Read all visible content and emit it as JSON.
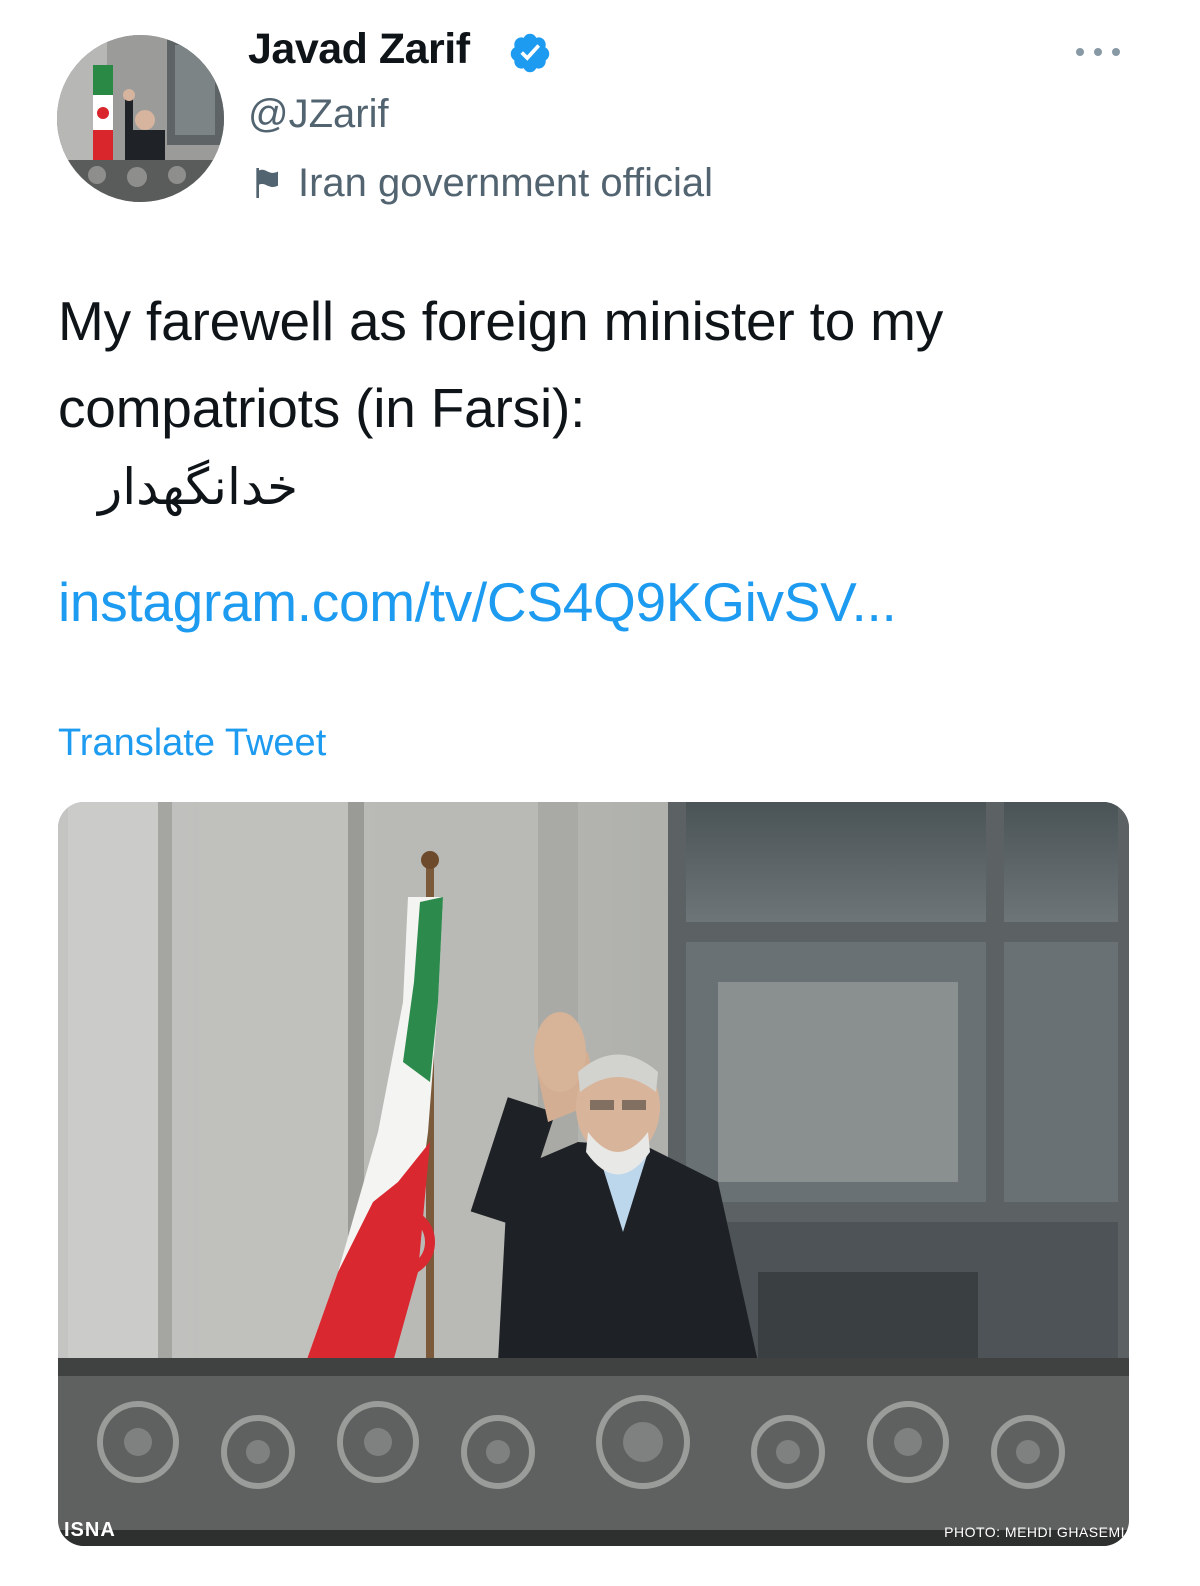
{
  "author": {
    "display_name": "Javad Zarif",
    "handle": "@JZarif",
    "label": "Iran government official",
    "verified": true,
    "avatar_icon": "avatar-photo"
  },
  "tweet": {
    "text": "My farewell as foreign minister to my compatriots (in Farsi):",
    "farsi_text": "خدانگهدار",
    "link": "instagram.com/tv/CS4Q9KGivSV...",
    "translate_label": "Translate Tweet"
  },
  "media": {
    "watermark_left": "ISNA",
    "watermark_right": "PHOTO: MEHDI GHASEMI"
  },
  "colors": {
    "accent": "#1d9bf0",
    "text_primary": "#0f1419",
    "text_secondary": "#536471"
  }
}
